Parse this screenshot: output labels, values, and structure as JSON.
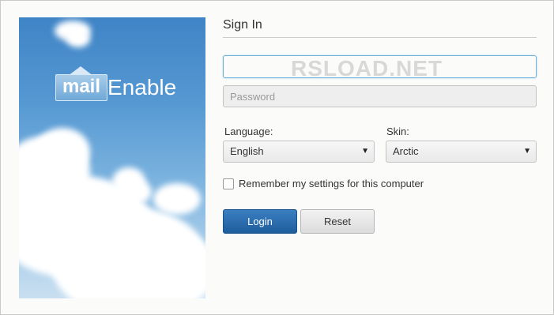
{
  "brand": {
    "logo_mark": "mail",
    "logo_word": "Enable",
    "background_image": "blue sky with white clouds"
  },
  "form": {
    "title": "Sign In",
    "username": {
      "value": "",
      "placeholder": ""
    },
    "password": {
      "value": "",
      "placeholder": "Password"
    },
    "language": {
      "label": "Language:",
      "selected": "English"
    },
    "skin": {
      "label": "Skin:",
      "selected": "Arctic"
    },
    "remember": {
      "label": "Remember my settings for this computer",
      "checked": false
    },
    "login_label": "Login",
    "reset_label": "Reset"
  },
  "watermark": "RSLOAD.NET",
  "icons": {
    "dropdown": "chevron-down-icon",
    "logo": "envelope-icon"
  },
  "colors": {
    "primary_button": "#2a6aad",
    "focus_border": "#6fb0d8",
    "sky": "#4a8ccb"
  }
}
